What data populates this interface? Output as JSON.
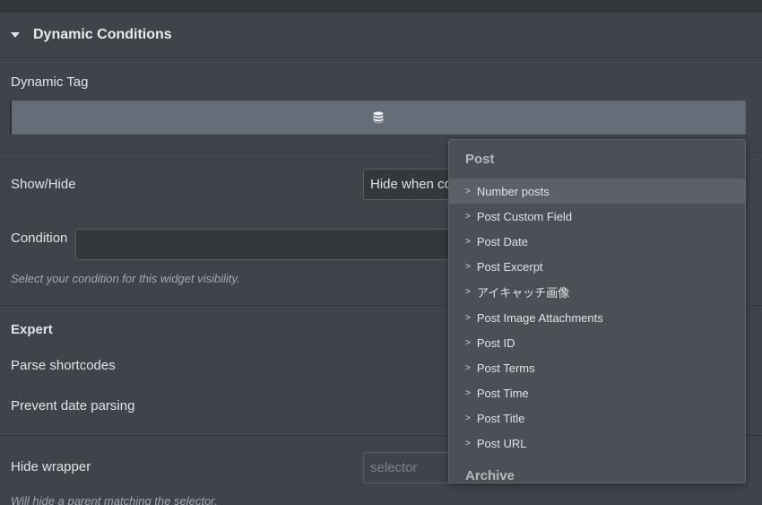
{
  "section": {
    "title": "Dynamic Conditions"
  },
  "dynamic_tag": {
    "label": "Dynamic Tag",
    "icon": "database-icon"
  },
  "show_hide": {
    "label": "Show/Hide",
    "value": "Hide when co"
  },
  "condition": {
    "label": "Condition",
    "value": "",
    "help": "Select your condition for this widget visibility."
  },
  "expert": {
    "heading": "Expert",
    "parse_shortcodes": "Parse shortcodes",
    "prevent_date_parsing": "Prevent date parsing"
  },
  "hide_wrapper": {
    "label": "Hide wrapper",
    "placeholder": "selector",
    "help": "Will hide a parent matching the selector."
  },
  "dropdown": {
    "group_post": "Post",
    "items": [
      {
        "label": "Number posts",
        "active": true
      },
      {
        "label": "Post Custom Field",
        "active": false
      },
      {
        "label": "Post Date",
        "active": false
      },
      {
        "label": "Post Excerpt",
        "active": false
      },
      {
        "label": "アイキャッチ画像",
        "active": false
      },
      {
        "label": "Post Image Attachments",
        "active": false
      },
      {
        "label": "Post ID",
        "active": false
      },
      {
        "label": "Post Terms",
        "active": false
      },
      {
        "label": "Post Time",
        "active": false
      },
      {
        "label": "Post Title",
        "active": false
      },
      {
        "label": "Post URL",
        "active": false
      }
    ],
    "chevron": ">",
    "group_archive": "Archive"
  },
  "colors": {
    "panel_bg": "#404349",
    "dropdown_bg": "#4c4f55",
    "dynamic_bar": "#656e78",
    "active_item": "#5d6066"
  }
}
